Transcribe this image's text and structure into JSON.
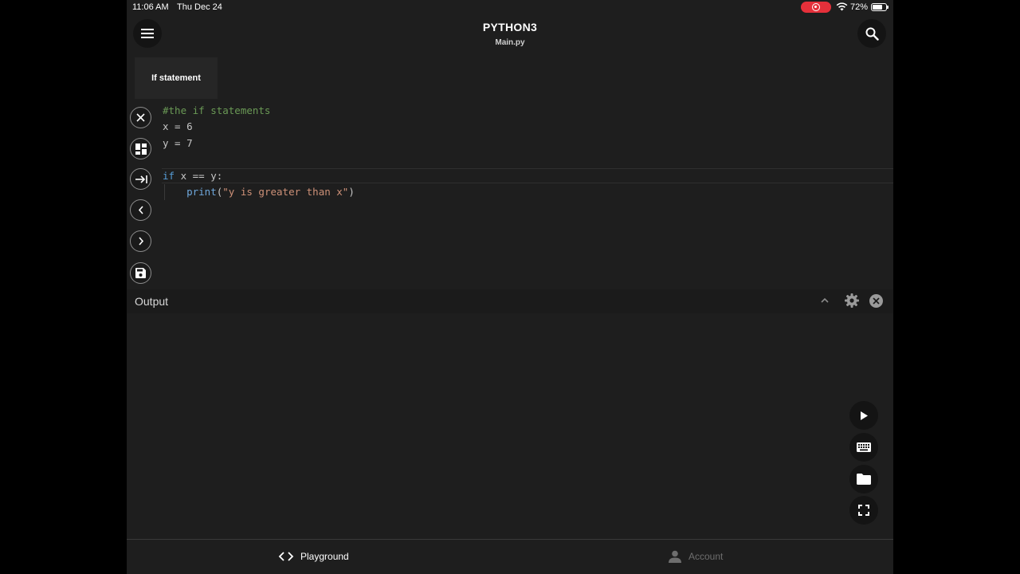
{
  "status_bar": {
    "time": "11:06 AM",
    "date": "Thu Dec 24",
    "battery_percent": "72%",
    "battery_level": 0.72,
    "recording": true
  },
  "header": {
    "title": "PYTHON3",
    "file_name": "Main.py",
    "menu_icon": "hamburger-menu-icon",
    "search_icon": "search-icon"
  },
  "tabs": [
    {
      "label": "If statement",
      "active": true
    }
  ],
  "toolbar": {
    "items": [
      {
        "name": "close-file",
        "icon": "close-icon"
      },
      {
        "name": "layout",
        "icon": "dashboard-icon"
      },
      {
        "name": "indent",
        "icon": "tab-indent-icon"
      },
      {
        "name": "previous",
        "icon": "chevron-left-icon"
      },
      {
        "name": "next",
        "icon": "chevron-right-icon"
      },
      {
        "name": "save",
        "icon": "save-icon"
      }
    ]
  },
  "code": {
    "line1": {
      "comment": "#the if statements"
    },
    "line2": {
      "text": "x = 6"
    },
    "line3": {
      "text": "y = 7"
    },
    "line5": {
      "keyword": "if",
      "rest": " x == y:"
    },
    "line6": {
      "indent": "    ",
      "func": "print",
      "open": "(",
      "string": "\"y is greater than x\"",
      "close": ")"
    }
  },
  "output": {
    "label": "Output",
    "collapse_icon": "chevron-up-icon",
    "settings_icon": "gear-icon",
    "close_icon": "close-circle-icon"
  },
  "actions": {
    "run_icon": "play-icon",
    "keyboard_icon": "keyboard-icon",
    "files_icon": "folder-icon",
    "fullscreen_icon": "fullscreen-icon"
  },
  "bottom_nav": {
    "playground": "Playground",
    "account": "Account"
  },
  "colors": {
    "background": "#1e1e1e",
    "comment": "#6a9955",
    "keyword": "#569cd6",
    "string": "#ce9178",
    "record": "#e5303a"
  }
}
